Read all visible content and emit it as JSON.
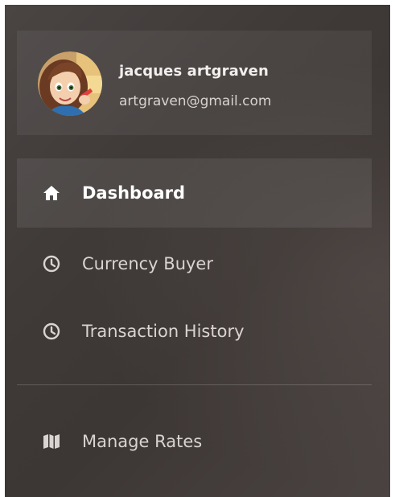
{
  "user": {
    "name": "jacques artgraven",
    "email": "artgraven@gmail.com"
  },
  "nav": {
    "items": [
      {
        "label": "Dashboard",
        "icon": "home-icon",
        "active": true
      },
      {
        "label": "Currency Buyer",
        "icon": "clock-icon",
        "active": false
      },
      {
        "label": "Transaction History",
        "icon": "clock-icon",
        "active": false
      },
      {
        "label": "Manage Rates",
        "icon": "map-icon",
        "active": false
      }
    ]
  },
  "colors": {
    "sidebar_bg": "#3f3a38",
    "text_primary": "#ffffff",
    "text_secondary": "#d9d4d2"
  }
}
